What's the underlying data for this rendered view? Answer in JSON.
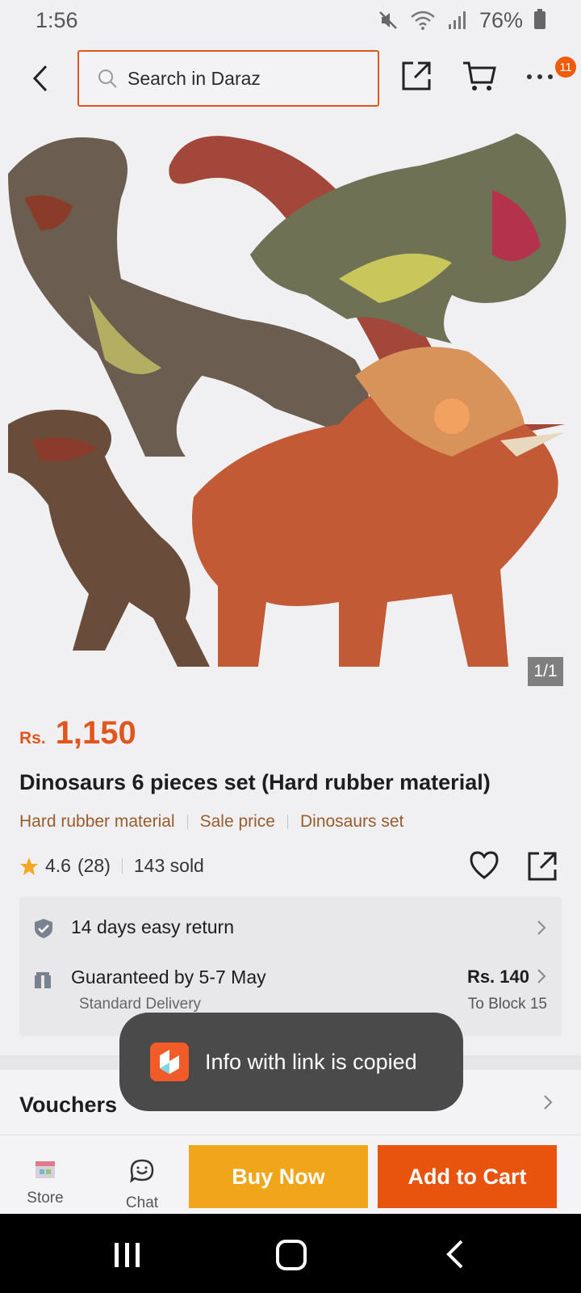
{
  "status": {
    "time": "1:56",
    "battery": "76%"
  },
  "header": {
    "search_placeholder": "Search in Daraz",
    "cart_badge": "11"
  },
  "gallery": {
    "counter": "1/1"
  },
  "product": {
    "currency": "Rs.",
    "price": "1,150",
    "title": "Dinosaurs 6 pieces set (Hard rubber material)",
    "tags": [
      "Hard rubber material",
      "Sale price",
      "Dinosaurs set"
    ],
    "rating": "4.6",
    "review_count": "(28)",
    "sold": "143 sold"
  },
  "services": {
    "return_label": "14 days easy return",
    "delivery_label": "Guaranteed by 5-7 May",
    "delivery_type": "Standard Delivery",
    "delivery_fee": "Rs. 140",
    "delivery_to": "To Block 15"
  },
  "vouchers": {
    "label": "Vouchers"
  },
  "toast": {
    "message": "Info with link is copied"
  },
  "bottom": {
    "store_label": "Store",
    "chat_label": "Chat",
    "buy_now": "Buy Now",
    "add_to_cart": "Add to Cart"
  },
  "colors": {
    "accent": "#e0561d",
    "buy_now": "#f0a51b",
    "add_to_cart": "#e8540e"
  }
}
